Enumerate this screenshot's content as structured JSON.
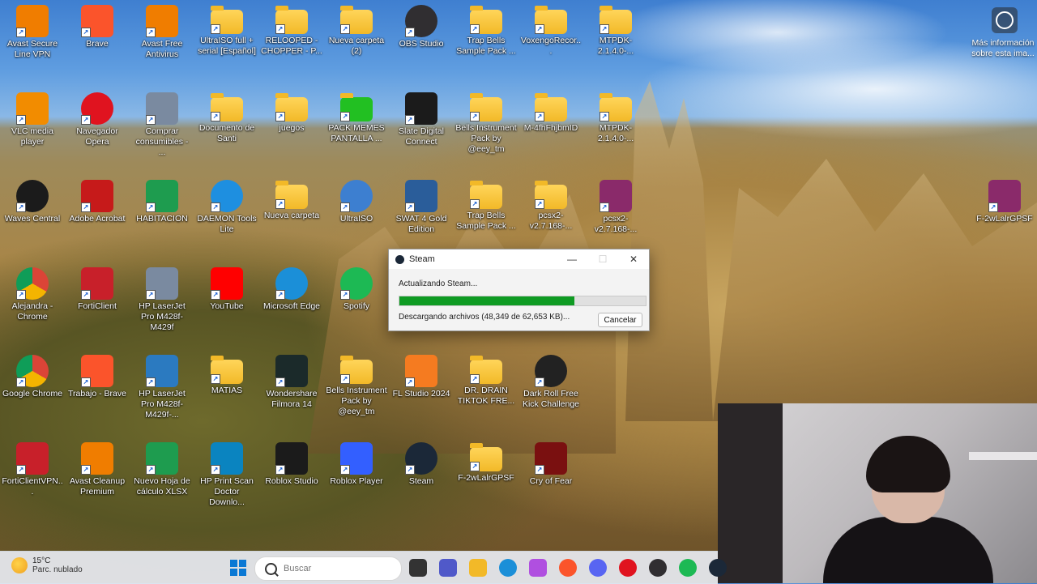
{
  "desktop_icons": [
    {
      "label": "Avast Secure Line VPN",
      "icon": "avast-vpn-icon",
      "color": "#f07d00"
    },
    {
      "label": "Brave",
      "icon": "brave-icon",
      "color": "#fb542b"
    },
    {
      "label": "Avast Free Antivirus",
      "icon": "avast-icon",
      "color": "#f07d00"
    },
    {
      "label": "UltraISO full + serial [Español]",
      "icon": "folder-icon",
      "color": "folder"
    },
    {
      "label": "RELOOPED - CHOPPER - P...",
      "icon": "folder-icon",
      "color": "folder"
    },
    {
      "label": "Nueva carpeta (2)",
      "icon": "folder-icon",
      "color": "folder"
    },
    {
      "label": "OBS Studio",
      "icon": "obs-icon",
      "color": "#302e31"
    },
    {
      "label": "Trap Bells Sample Pack ...",
      "icon": "folder-icon",
      "color": "folder"
    },
    {
      "label": "VoxengoRecor...",
      "icon": "folder-icon",
      "color": "folder"
    },
    {
      "label": "MTPDK-2.1.4.0-...",
      "icon": "folder-icon",
      "color": "folder"
    },
    {
      "label": "VLC media player",
      "icon": "vlc-icon",
      "color": "#f28c00"
    },
    {
      "label": "Navegador Opera",
      "icon": "opera-icon",
      "color": "#e0131f"
    },
    {
      "label": "Comprar consumibles - ...",
      "icon": "printer-icon",
      "color": "#7a8aa0"
    },
    {
      "label": "Documento de Santi",
      "icon": "folder-icon",
      "color": "folder"
    },
    {
      "label": "juegos",
      "icon": "folder-icon",
      "color": "folder"
    },
    {
      "label": "PACK MEMES PANTALLA ...",
      "icon": "folder-green-icon",
      "color": "#22c022"
    },
    {
      "label": "Slate Digital Connect",
      "icon": "slate-icon",
      "color": "#1b1b1b"
    },
    {
      "label": "Bells Instrument Pack by @eey_tm",
      "icon": "folder-icon",
      "color": "folder"
    },
    {
      "label": "M-4fhFhjbmID",
      "icon": "folder-icon",
      "color": "folder"
    },
    {
      "label": "MTPDK-2.1.4.0-...",
      "icon": "folder-icon",
      "color": "folder"
    },
    {
      "label": "Waves Central",
      "icon": "waves-icon",
      "color": "#1b1b1b"
    },
    {
      "label": "Adobe Acrobat",
      "icon": "acrobat-icon",
      "color": "#c61a1a"
    },
    {
      "label": "HABITACION",
      "icon": "sheets-icon",
      "color": "#1e9c4f"
    },
    {
      "label": "DAEMON Tools Lite",
      "icon": "daemon-icon",
      "color": "#1e8fe0"
    },
    {
      "label": "Nueva carpeta",
      "icon": "folder-icon",
      "color": "folder"
    },
    {
      "label": "UltraISO",
      "icon": "ultraiso-icon",
      "color": "#3d7fd0"
    },
    {
      "label": "SWAT 4 Gold Edition",
      "icon": "swat-icon",
      "color": "#2a5d9a"
    },
    {
      "label": "Trap Bells Sample Pack ...",
      "icon": "folder-icon",
      "color": "folder"
    },
    {
      "label": "pcsx2-v2.7.168-...",
      "icon": "folder-icon",
      "color": "folder"
    },
    {
      "label": "pcsx2-v2.7.168-...",
      "icon": "winrar-icon",
      "color": "#8a2a6a"
    },
    {
      "label": "Alejandra - Chrome",
      "icon": "chrome-icon",
      "color": "#2f8fe0"
    },
    {
      "label": "FortiClient",
      "icon": "forticlient-icon",
      "color": "#c8202a"
    },
    {
      "label": "HP LaserJet Pro M428f-M429f",
      "icon": "printer-icon",
      "color": "#7a8aa0"
    },
    {
      "label": "YouTube",
      "icon": "youtube-icon",
      "color": "#ff0000"
    },
    {
      "label": "Microsoft Edge",
      "icon": "edge-icon",
      "color": "#1b8fd8"
    },
    {
      "label": "Spotify",
      "icon": "spotify-icon",
      "color": "#1db954"
    },
    {
      "label": "Google Chrome",
      "icon": "chrome-icon",
      "color": "#2f8fe0"
    },
    {
      "label": "Trabajo - Brave",
      "icon": "brave-icon",
      "color": "#fb542b"
    },
    {
      "label": "HP LaserJet Pro M428f-M429f-...",
      "icon": "scanner-icon",
      "color": "#2b7ac0"
    },
    {
      "label": "MATIAS",
      "icon": "folder-icon",
      "color": "folder"
    },
    {
      "label": "Wondershare Filmora 14",
      "icon": "filmora-icon",
      "color": "#1b2a2a"
    },
    {
      "label": "Bells Instrument Pack by @eey_tm",
      "icon": "folder-icon",
      "color": "folder"
    },
    {
      "label": "FL Studio 2024",
      "icon": "flstudio-icon",
      "color": "#f57b20"
    },
    {
      "label": "DR. DRAIN TIKTOK FRE...",
      "icon": "folder-icon",
      "color": "folder"
    },
    {
      "label": "Dark Roll Free Kick Challenge",
      "icon": "football-icon",
      "color": "#222222"
    },
    {
      "label": "FortiClientVPN...",
      "icon": "forticlient-icon",
      "color": "#c8202a"
    },
    {
      "label": "Avast Cleanup Premium",
      "icon": "avast-cleanup-icon",
      "color": "#f07d00"
    },
    {
      "label": "Nuevo Hoja de cálculo XLSX",
      "icon": "sheets-icon",
      "color": "#1e9c4f"
    },
    {
      "label": "HP Print Scan Doctor Downlo...",
      "icon": "hp-icon",
      "color": "#0a84c0"
    },
    {
      "label": "Roblox Studio",
      "icon": "roblox-studio-icon",
      "color": "#1b1b1b"
    },
    {
      "label": "Roblox Player",
      "icon": "roblox-icon",
      "color": "#335fff"
    },
    {
      "label": "Steam",
      "icon": "steam-icon",
      "color": "#1b2838"
    },
    {
      "label": "F-2wLalrGPSF",
      "icon": "folder-icon",
      "color": "folder"
    },
    {
      "label": "Cry of Fear",
      "icon": "cryoffear-icon",
      "color": "#7a1010"
    },
    {
      "label": "F-2wLalrGPSF",
      "icon": "winrar-icon",
      "color": "#8a2a6a"
    }
  ],
  "info_widget": {
    "label": "Más información sobre esta ima..."
  },
  "steam_dialog": {
    "title": "Steam",
    "status": "Actualizando Steam...",
    "progress": 0.71,
    "detail": "Descargando archivos (48,349 de 62,653 KB)...",
    "cancel_label": "Cancelar",
    "minimize": "—",
    "maximize": "☐",
    "close": "✕"
  },
  "taskbar": {
    "weather_temp": "15°C",
    "weather_desc": "Parc. nublado",
    "search_placeholder": "Buscar",
    "pinned": [
      {
        "name": "task-view-icon",
        "color": "#333333"
      },
      {
        "name": "teams-icon",
        "color": "#5059c9"
      },
      {
        "name": "file-explorer-icon",
        "color": "#f2b928"
      },
      {
        "name": "edge-icon",
        "color": "#1b8fd8"
      },
      {
        "name": "copilot-icon",
        "color": "#b04fe0"
      },
      {
        "name": "brave-icon",
        "color": "#fb542b"
      },
      {
        "name": "discord-icon",
        "color": "#5865f2"
      },
      {
        "name": "opera-icon",
        "color": "#e0131f"
      },
      {
        "name": "obs-icon",
        "color": "#302e31"
      },
      {
        "name": "spotify-icon",
        "color": "#1db954"
      },
      {
        "name": "steam-icon",
        "color": "#1b2838"
      }
    ]
  },
  "colors": {
    "progress_fill": "#0f9b23",
    "accent": "#0067c0"
  }
}
